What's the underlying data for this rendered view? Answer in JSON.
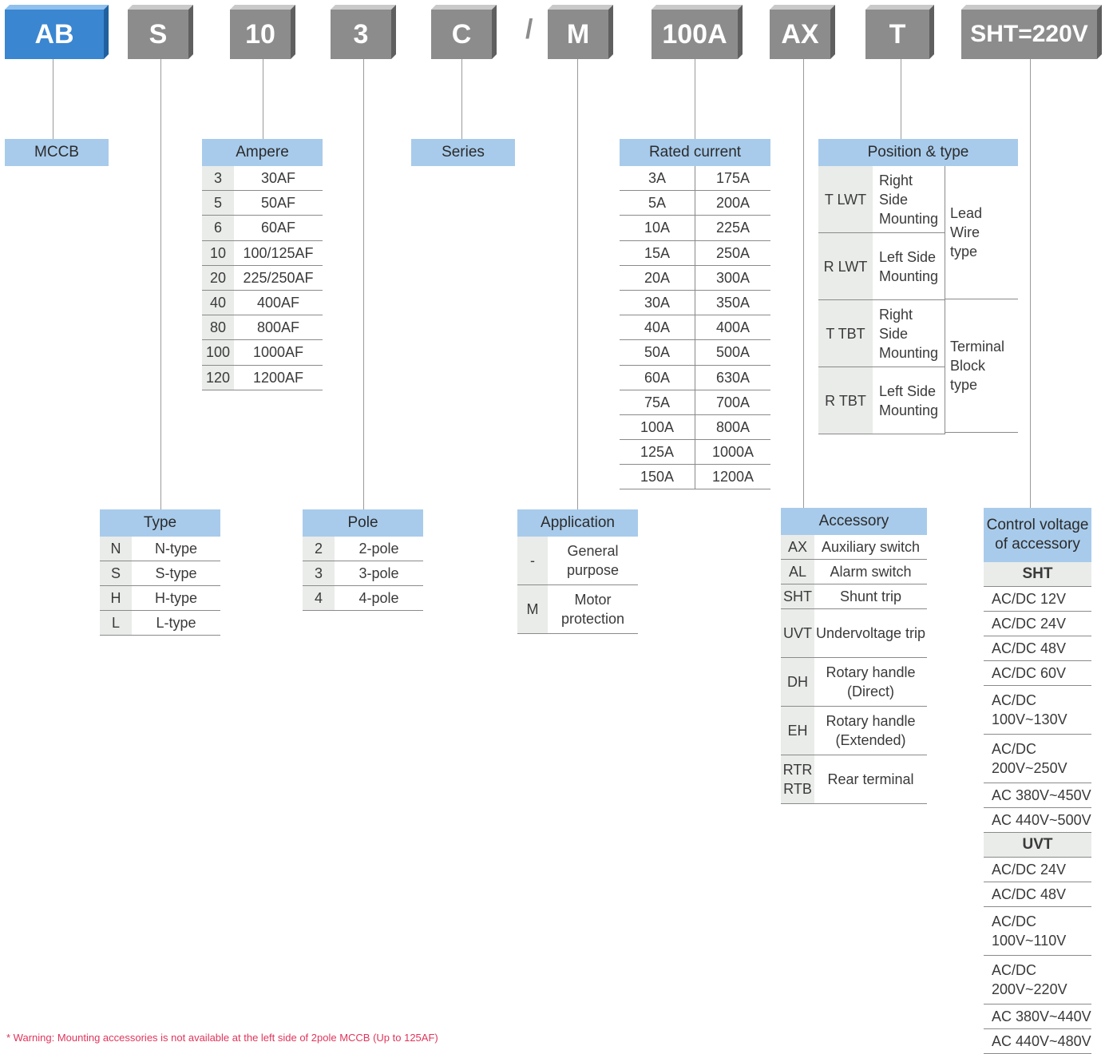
{
  "codes": [
    "AB",
    "S",
    "10",
    "3",
    "C",
    "M",
    "100A",
    "AX",
    "T",
    "SHT=220V"
  ],
  "slash": "/",
  "colors": {
    "accent": "#3a86d0",
    "header": "#a8cbeb",
    "code_box": "#8c8c8c",
    "key_cell": "#e9ece9",
    "warning": "#e0355b"
  },
  "mccb": {
    "title": "MCCB"
  },
  "series": {
    "title": "Series"
  },
  "ampere": {
    "title": "Ampere",
    "rows": [
      [
        "3",
        "30AF"
      ],
      [
        "5",
        "50AF"
      ],
      [
        "6",
        "60AF"
      ],
      [
        "10",
        "100/125AF"
      ],
      [
        "20",
        "225/250AF"
      ],
      [
        "40",
        "400AF"
      ],
      [
        "80",
        "800AF"
      ],
      [
        "100",
        "1000AF"
      ],
      [
        "120",
        "1200AF"
      ]
    ]
  },
  "type": {
    "title": "Type",
    "rows": [
      [
        "N",
        "N-type"
      ],
      [
        "S",
        "S-type"
      ],
      [
        "H",
        "H-type"
      ],
      [
        "L",
        "L-type"
      ]
    ]
  },
  "pole": {
    "title": "Pole",
    "rows": [
      [
        "2",
        "2-pole"
      ],
      [
        "3",
        "3-pole"
      ],
      [
        "4",
        "4-pole"
      ]
    ]
  },
  "application": {
    "title": "Application",
    "rows": [
      [
        "-",
        "General purpose"
      ],
      [
        "M",
        "Motor protection"
      ]
    ]
  },
  "rated": {
    "title": "Rated current",
    "rows": [
      [
        "3A",
        "175A"
      ],
      [
        "5A",
        "200A"
      ],
      [
        "10A",
        "225A"
      ],
      [
        "15A",
        "250A"
      ],
      [
        "20A",
        "300A"
      ],
      [
        "30A",
        "350A"
      ],
      [
        "40A",
        "400A"
      ],
      [
        "50A",
        "500A"
      ],
      [
        "60A",
        "630A"
      ],
      [
        "75A",
        "700A"
      ],
      [
        "100A",
        "800A"
      ],
      [
        "125A",
        "1000A"
      ],
      [
        "150A",
        "1200A"
      ]
    ]
  },
  "position": {
    "title": "Position & type",
    "rows": [
      [
        "T LWT",
        "Right Side Mounting"
      ],
      [
        "R LWT",
        "Left Side Mounting"
      ],
      [
        "T TBT",
        "Right Side Mounting"
      ],
      [
        "R TBT",
        "Left Side Mounting"
      ]
    ],
    "groups": [
      "Lead Wire type",
      "Terminal Block type"
    ]
  },
  "accessory": {
    "title": "Accessory",
    "rows": [
      [
        "AX",
        "Auxiliary switch"
      ],
      [
        "AL",
        "Alarm switch"
      ],
      [
        "SHT",
        "Shunt trip"
      ],
      [
        "UVT",
        "Undervoltage trip"
      ],
      [
        "DH",
        "Rotary handle (Direct)"
      ],
      [
        "EH",
        "Rotary handle (Extended)"
      ],
      [
        "RTR RTB",
        "Rear terminal"
      ]
    ]
  },
  "control": {
    "title": "Control voltage of accessory",
    "sht_title": "SHT",
    "sht": [
      "AC/DC 12V",
      "AC/DC 24V",
      "AC/DC 48V",
      "AC/DC 60V",
      "AC/DC 100V~130V",
      "AC/DC 200V~250V",
      "AC 380V~450V",
      "AC 440V~500V"
    ],
    "uvt_title": "UVT",
    "uvt": [
      "AC/DC 24V",
      "AC/DC 48V",
      "AC/DC 100V~110V",
      "AC/DC 200V~220V",
      "AC 380V~440V",
      "AC 440V~480V"
    ]
  },
  "warning": "* Warning: Mounting accessories is not available at the left side of 2pole MCCB (Up to 125AF)"
}
